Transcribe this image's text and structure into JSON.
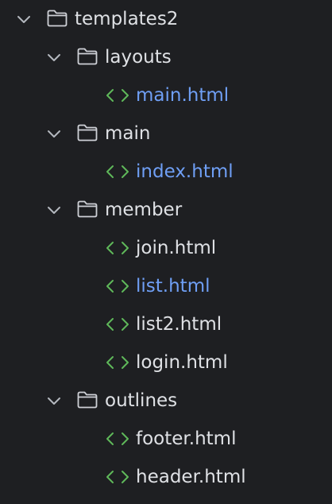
{
  "tree": {
    "root": {
      "label": "templates2",
      "icon": "folder-icon",
      "expanded": true
    },
    "folders": [
      {
        "key": "layouts",
        "label": "layouts",
        "expanded": true,
        "files": [
          {
            "label": "main.html",
            "modified": true
          }
        ]
      },
      {
        "key": "main",
        "label": "main",
        "expanded": true,
        "files": [
          {
            "label": "index.html",
            "modified": true
          }
        ]
      },
      {
        "key": "member",
        "label": "member",
        "expanded": true,
        "files": [
          {
            "label": "join.html",
            "modified": false
          },
          {
            "label": "list.html",
            "modified": true
          },
          {
            "label": "list2.html",
            "modified": false
          },
          {
            "label": "login.html",
            "modified": false
          }
        ]
      },
      {
        "key": "outlines",
        "label": "outlines",
        "expanded": true,
        "files": [
          {
            "label": "footer.html",
            "modified": false
          },
          {
            "label": "header.html",
            "modified": false
          }
        ]
      }
    ]
  },
  "colors": {
    "background": "#1e1f22",
    "text": "#dfe1e5",
    "modified_text": "#6f9ff5",
    "html_icon": "#5fb85a",
    "chevron": "#b4b8bf",
    "folder_stroke": "#ced0d6"
  },
  "icons": {
    "chevron": "chevron-down-icon",
    "folder": "folder-icon",
    "html_file": "html-file-icon"
  }
}
